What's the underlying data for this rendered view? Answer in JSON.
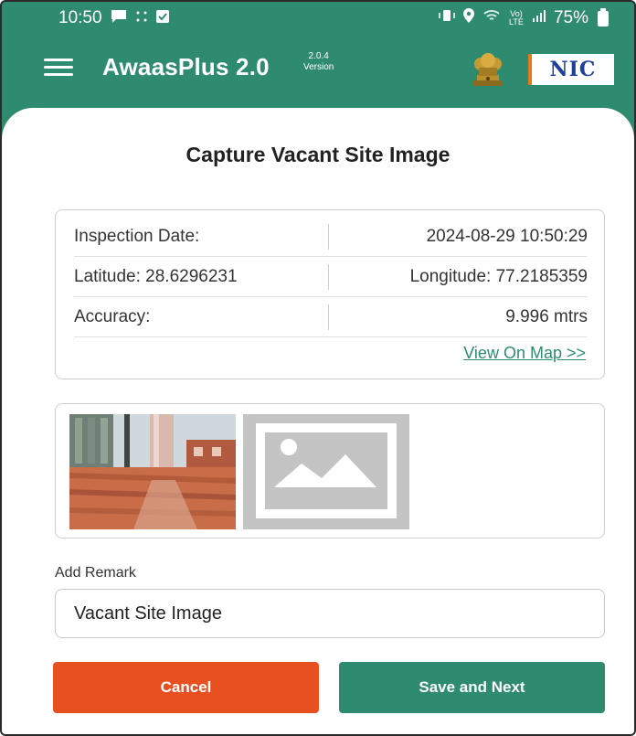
{
  "status_bar": {
    "time": "10:50",
    "left_icons": [
      "chat-bubble-icon",
      "dots-icon",
      "notification-icon"
    ],
    "right_icons": [
      "vibrate-icon",
      "location-icon",
      "wifi-icon",
      "signal-icon"
    ],
    "network_label": "Vo) LTE",
    "battery": "75%"
  },
  "app_bar": {
    "title": "AwaasPlus 2.0",
    "version_number": "2.0.4",
    "version_label": "Version",
    "nic_logo": "NIC"
  },
  "colors": {
    "primary": "#2e8b6f",
    "cancel": "#e8501f",
    "link": "#2e8b6f"
  },
  "screen": {
    "title": "Capture Vacant Site Image"
  },
  "info": {
    "inspection_date_label": "Inspection Date:",
    "inspection_date_value": "2024-08-29 10:50:29",
    "latitude": "Latitude: 28.6296231",
    "longitude": "Longitude: 77.2185359",
    "accuracy_label": "Accuracy:",
    "accuracy_value": "9.996 mtrs",
    "view_map": "View On Map >>"
  },
  "photos": {
    "captured_icon": "site-photo-thumbnail",
    "placeholder_icon": "image-placeholder-icon"
  },
  "remark": {
    "label": "Add Remark",
    "value": "Vacant Site Image"
  },
  "buttons": {
    "cancel": "Cancel",
    "save_next": "Save and Next"
  }
}
